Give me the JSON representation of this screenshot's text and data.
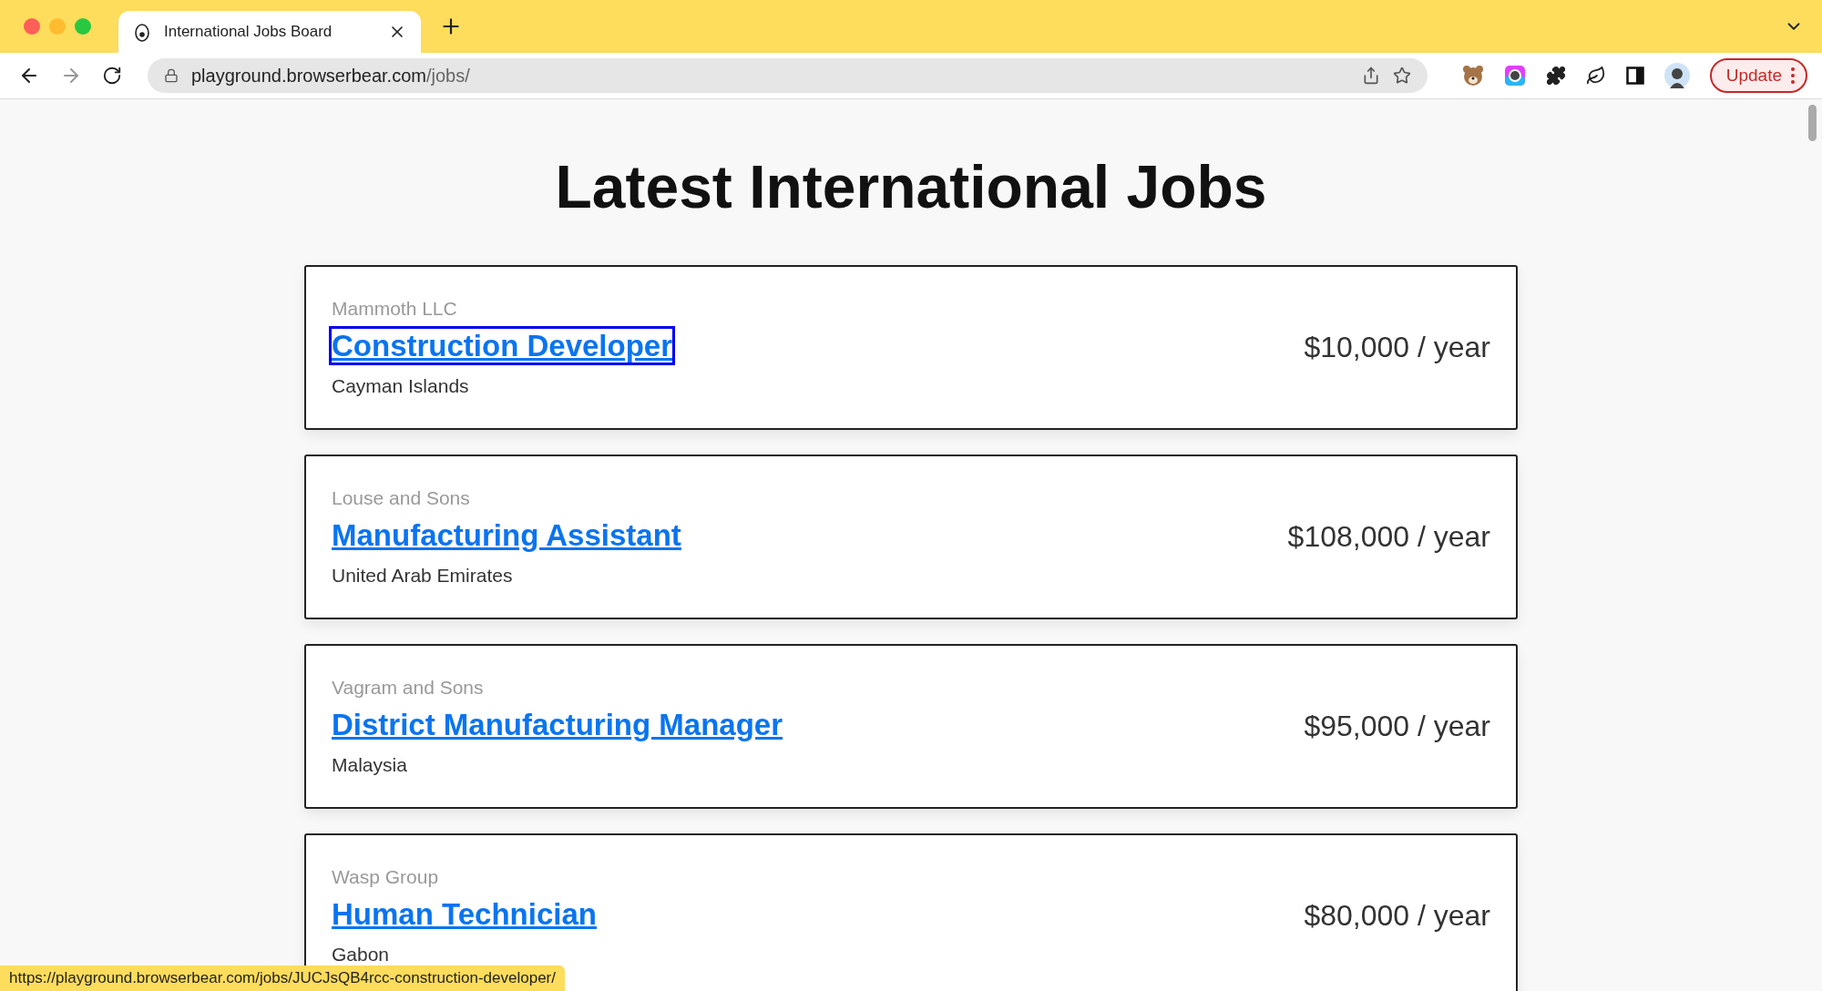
{
  "browser": {
    "tab": {
      "title": "International Jobs Board",
      "selected": true
    },
    "address": {
      "host": "playground.browserbear.com",
      "path": "/jobs/"
    },
    "update_button": "Update"
  },
  "page": {
    "title": "Latest International Jobs",
    "jobs": [
      {
        "company": "Mammoth LLC",
        "title": "Construction Developer",
        "location": "Cayman Islands",
        "salary": "$10,000 / year",
        "focused": true
      },
      {
        "company": "Louse and Sons",
        "title": "Manufacturing Assistant",
        "location": "United Arab Emirates",
        "salary": "$108,000 / year",
        "focused": false
      },
      {
        "company": "Vagram and Sons",
        "title": "District Manufacturing Manager",
        "location": "Malaysia",
        "salary": "$95,000 / year",
        "focused": false
      },
      {
        "company": "Wasp Group",
        "title": "Human Technician",
        "location": "Gabon",
        "salary": "$80,000 / year",
        "focused": false
      }
    ]
  },
  "status_url": "https://playground.browserbear.com/jobs/JUCJsQB4rcc-construction-developer/"
}
